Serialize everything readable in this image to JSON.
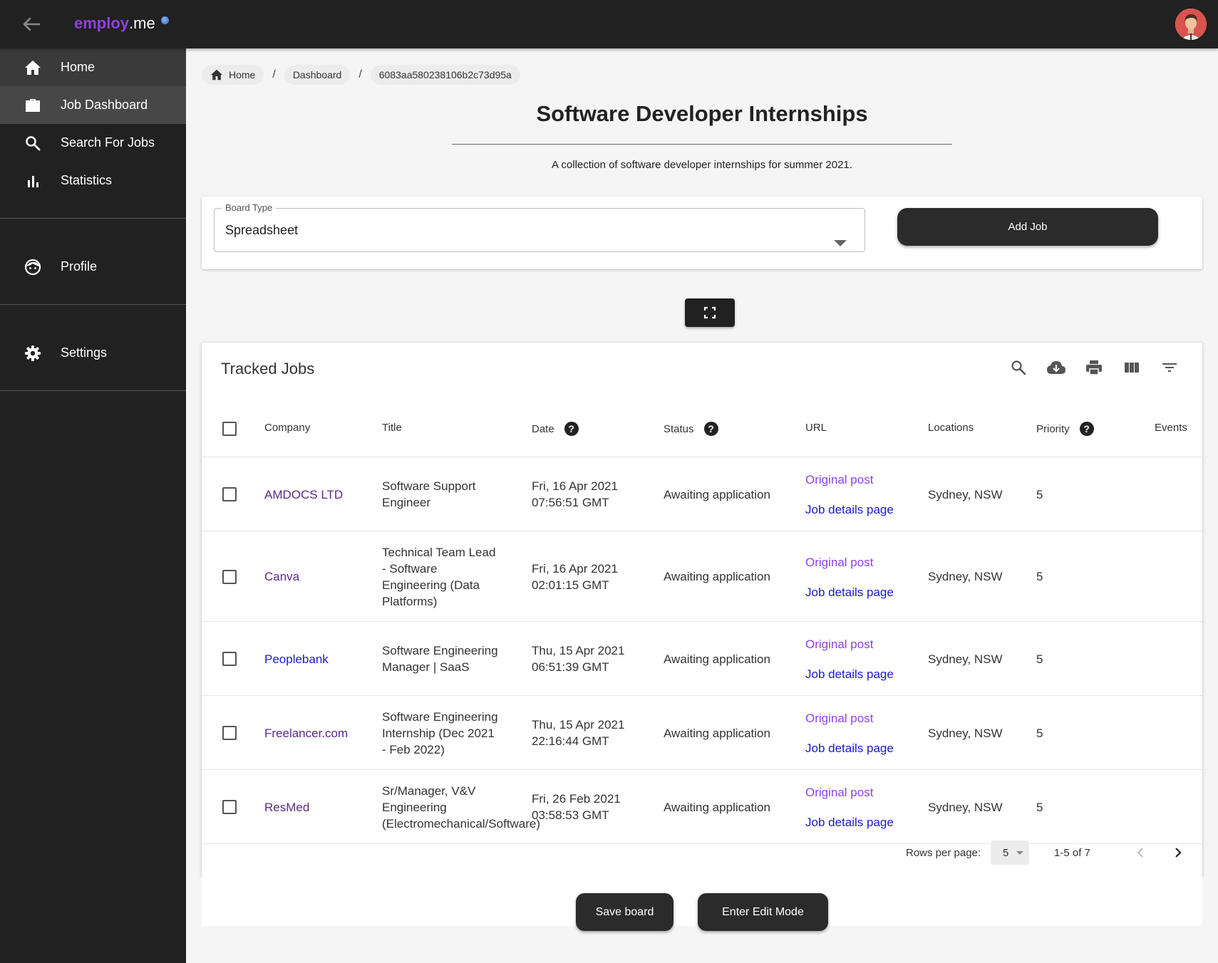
{
  "app": {
    "brand_part1": "employ",
    "brand_part2": ".me",
    "accent": "#8e3fe6",
    "link_color": "#1a1acc"
  },
  "sidebar": {
    "items": [
      {
        "label": "Home",
        "icon": "home-icon"
      },
      {
        "label": "Job Dashboard",
        "icon": "briefcase-icon"
      },
      {
        "label": "Search For Jobs",
        "icon": "search-icon"
      },
      {
        "label": "Statistics",
        "icon": "bar-chart-icon"
      },
      {
        "label": "Profile",
        "icon": "face-icon"
      },
      {
        "label": "Settings",
        "icon": "gear-icon"
      }
    ]
  },
  "breadcrumb": {
    "home": "Home",
    "dashboard": "Dashboard",
    "id": "6083aa580238106b2c73d95a",
    "separator": "/"
  },
  "board": {
    "title": "Software Developer Internships",
    "description": "A collection of software developer internships for summer 2021.",
    "type_label": "Board Type",
    "type_value": "Spreadsheet",
    "add_job_label": "Add Job"
  },
  "table": {
    "title": "Tracked Jobs",
    "columns": {
      "company": "Company",
      "title": "Title",
      "date": "Date",
      "status": "Status",
      "url": "URL",
      "locations": "Locations",
      "priority": "Priority",
      "events": "Events"
    },
    "help_glyph": "?",
    "rows": [
      {
        "company": "AMDOCS LTD",
        "company_color": "#5b2a86",
        "title": [
          "Software Support",
          "Engineer"
        ],
        "date": [
          "Fri, 16 Apr 2021",
          "07:56:51 GMT"
        ],
        "status": "Awaiting application",
        "url_original": "Original post",
        "url_details": "Job details page",
        "location": "Sydney, NSW",
        "priority": "5"
      },
      {
        "company": "Canva",
        "company_color": "#5b2a86",
        "title": [
          "Technical Team Lead",
          "- Software",
          "Engineering (Data",
          "Platforms)"
        ],
        "date": [
          "Fri, 16 Apr 2021",
          "02:01:15 GMT"
        ],
        "status": "Awaiting application",
        "url_original": "Original post",
        "url_details": "Job details page",
        "location": "Sydney, NSW",
        "priority": "5"
      },
      {
        "company": "Peoplebank",
        "company_color": "#1a1acc",
        "title": [
          "Software Engineering",
          "Manager | SaaS"
        ],
        "date": [
          "Thu, 15 Apr 2021",
          "06:51:39 GMT"
        ],
        "status": "Awaiting application",
        "url_original": "Original post",
        "url_details": "Job details page",
        "location": "Sydney, NSW",
        "priority": "5"
      },
      {
        "company": "Freelancer.com",
        "company_color": "#5b2a86",
        "title": [
          "Software Engineering",
          "Internship (Dec 2021",
          "- Feb 2022)"
        ],
        "date": [
          "Thu, 15 Apr 2021",
          "22:16:44 GMT"
        ],
        "status": "Awaiting application",
        "url_original": "Original post",
        "url_details": "Job details page",
        "location": "Sydney, NSW",
        "priority": "5"
      },
      {
        "company": "ResMed",
        "company_color": "#5b2a86",
        "title": [
          "Sr/Manager, V&V",
          "Engineering",
          "(Electromechanical/Software)"
        ],
        "date": [
          "Fri, 26 Feb 2021",
          "03:58:53 GMT"
        ],
        "status": "Awaiting application",
        "url_original": "Original post",
        "url_details": "Job details page",
        "location": "Sydney, NSW",
        "priority": "5"
      }
    ],
    "pagination": {
      "rows_per_page_label": "Rows per page:",
      "rows_per_page_value": "5",
      "range": "1-5 of 7"
    }
  },
  "actions": {
    "save_label": "Save board",
    "edit_label": "Enter Edit Mode"
  }
}
